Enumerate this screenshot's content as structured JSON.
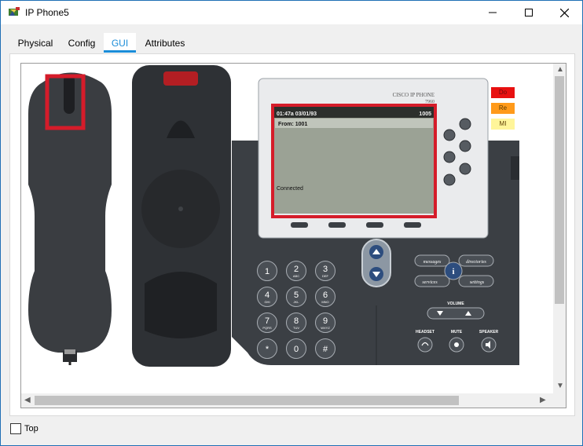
{
  "window": {
    "title": "IP Phone5",
    "controls": [
      "minimize",
      "maximize",
      "close"
    ]
  },
  "tabs": [
    {
      "label": "Physical",
      "active": false
    },
    {
      "label": "Config",
      "active": false
    },
    {
      "label": "GUI",
      "active": true
    },
    {
      "label": "Attributes",
      "active": false
    }
  ],
  "phone": {
    "brand": "CISCO IP PHONE",
    "model": "7960",
    "screen": {
      "time_date": "01:47a 03/01/93",
      "extension": "1005",
      "from": "From: 1001",
      "status": "Connected"
    },
    "softkey_labels": {
      "messages": "messages",
      "directories": "directories",
      "services": "services",
      "settings": "settings",
      "info": "i",
      "volume": "VOLUME",
      "headset": "HEADSET",
      "mute": "MUTE",
      "speaker": "SPEAKER"
    },
    "keypad": [
      {
        "digit": "1",
        "letters": ""
      },
      {
        "digit": "2",
        "letters": "ABC"
      },
      {
        "digit": "3",
        "letters": "DEF"
      },
      {
        "digit": "4",
        "letters": "GHI"
      },
      {
        "digit": "5",
        "letters": "JKL"
      },
      {
        "digit": "6",
        "letters": "MNO"
      },
      {
        "digit": "7",
        "letters": "PQRS"
      },
      {
        "digit": "8",
        "letters": "TUV"
      },
      {
        "digit": "9",
        "letters": "WXYZ"
      },
      {
        "digit": "*",
        "letters": ""
      },
      {
        "digit": "0",
        "letters": ""
      },
      {
        "digit": "#",
        "letters": ""
      }
    ],
    "status_buttons": [
      {
        "label": "Do",
        "color": "#e81010"
      },
      {
        "label": "Re",
        "color": "#ff9a1a"
      },
      {
        "label": "MI",
        "color": "#fff59a"
      }
    ]
  },
  "footer": {
    "top_label": "Top",
    "top_checked": false
  },
  "colors": {
    "accent": "#1a8cd8",
    "highlight": "#d51c2a",
    "phone_body": "#3b3f44",
    "lcd": "#9ba295"
  }
}
